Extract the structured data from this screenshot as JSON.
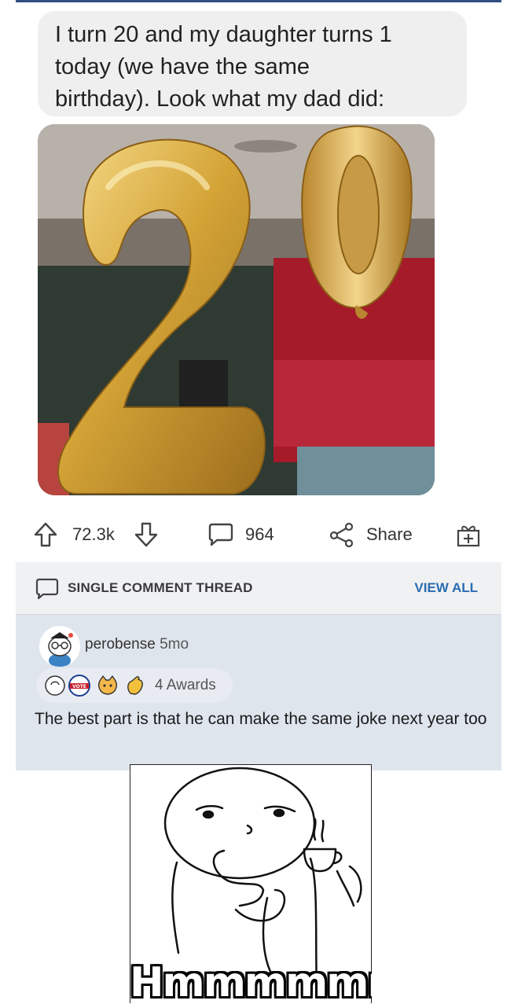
{
  "post": {
    "text_lines": [
      "I turn 20 and my daughter turns 1",
      "today (we have the same",
      "birthday). Look what my dad did:"
    ]
  },
  "actions": {
    "upvotes": "72.3k",
    "comments": "964",
    "share_label": "Share"
  },
  "thread": {
    "label": "SINGLE COMMENT THREAD",
    "view_all": "VIEW ALL"
  },
  "comment": {
    "username": "perobense",
    "time": "5mo",
    "awards": "4 Awards",
    "award_vote_text": "VOTE",
    "text": "The best part is that he can make the same joke next year too"
  },
  "meme": {
    "caption": "Hmmmmmm"
  },
  "colors": {
    "accent_link": "#2b6cb0",
    "comment_bg": "#dfe5ed",
    "balloon_gold": "#d4a437"
  }
}
